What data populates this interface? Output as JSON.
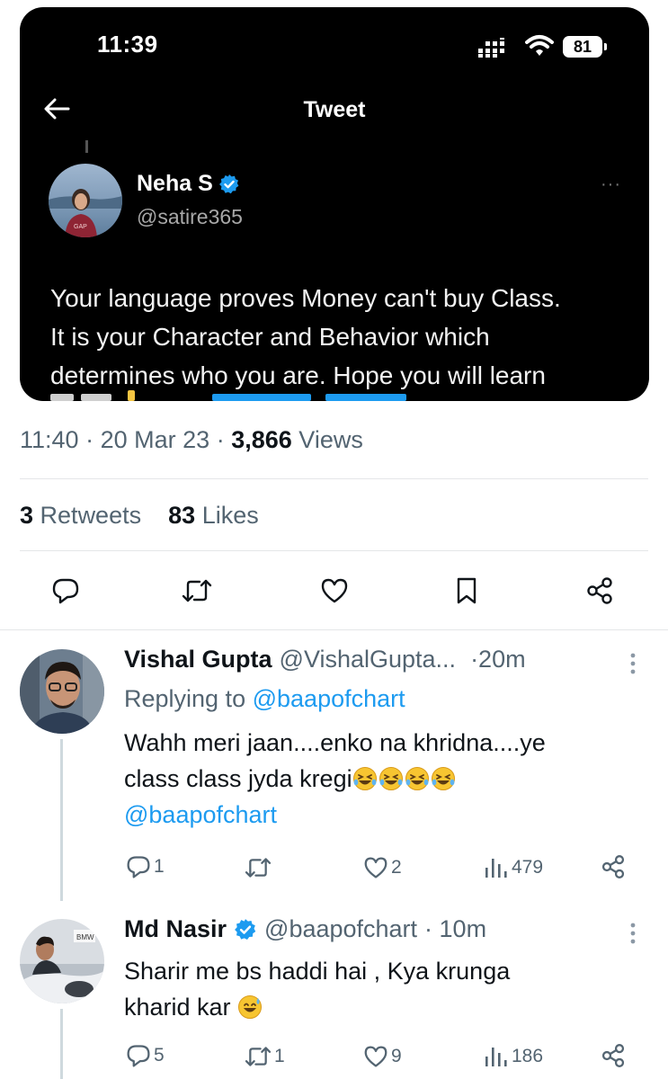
{
  "card": {
    "status_time": "11:39",
    "battery": "81",
    "title": "Tweet",
    "author_name": "Neha S",
    "author_handle": "@satire365",
    "more": "···",
    "text_lines": [
      "Your language proves Money can't buy Class.",
      "It is your Character and Behavior which",
      "determines who you are. Hope you will learn"
    ]
  },
  "meta": {
    "time": "11:40",
    "date": "20 Mar 23",
    "views_count": "3,866",
    "views_label": "Views",
    "sep": "·"
  },
  "stats": {
    "retweets_count": "3",
    "retweets_label": "Retweets",
    "likes_count": "83",
    "likes_label": "Likes"
  },
  "replies": [
    {
      "name": "Vishal Gupta",
      "handle": "@VishalGupta...",
      "time": "·20m",
      "replying_prefix": "Replying to",
      "replying_to": "@baapofchart",
      "text_lines": [
        "Wahh meri jaan....enko na khridna....ye",
        "class class jyda kregi"
      ],
      "mention": "@baapofchart",
      "reply_count": "1",
      "retweet_count": "",
      "like_count": "2",
      "views": "479"
    },
    {
      "name": "Md Nasir",
      "handle": "@baapofchart",
      "time": "· 10m",
      "text_lines": [
        "Sharir me bs haddi hai , Kya krunga",
        "kharid kar"
      ],
      "reply_count": "5",
      "retweet_count": "1",
      "like_count": "9",
      "views": "186"
    }
  ],
  "colors": {
    "accent": "#1d9bf0",
    "muted": "#536471",
    "verified": "#1d9bf0"
  },
  "icons": [
    "back-arrow-icon",
    "verified-icon",
    "reply-icon",
    "retweet-icon",
    "like-icon",
    "bookmark-icon",
    "share-icon",
    "views-icon",
    "more-icon"
  ]
}
